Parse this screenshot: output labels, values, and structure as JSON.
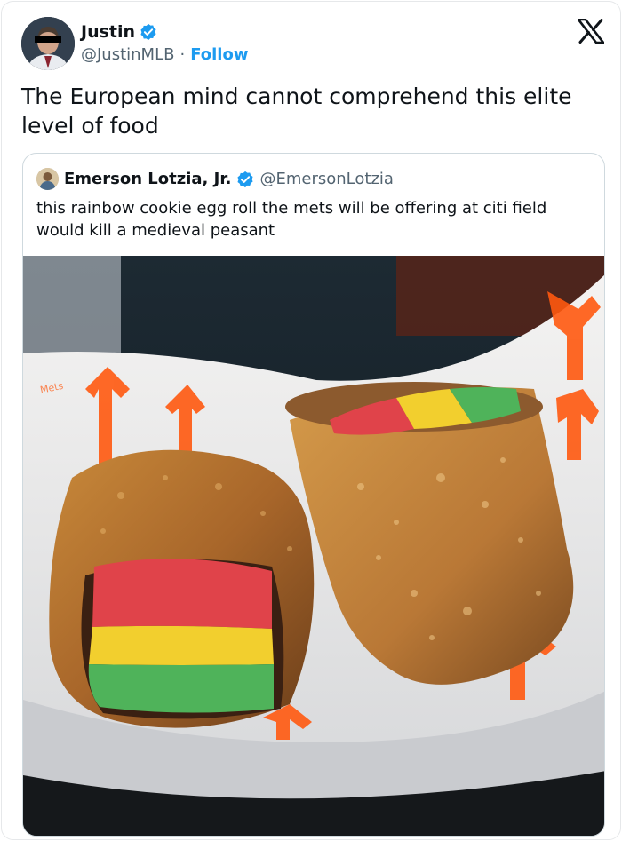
{
  "tweet": {
    "author_name": "Justin",
    "author_handle": "@JustinMLB",
    "separator": "·",
    "follow_label": "Follow",
    "text": "The European mind cannot comprehend this elite level of food"
  },
  "quoted_tweet": {
    "author_name": "Emerson Lotzia, Jr.",
    "author_handle": "@EmersonLotzia",
    "text": "this rainbow cookie egg roll the mets will be offering at citi field would kill a medieval peasant"
  },
  "colors": {
    "verified_badge": "#1d9bf0",
    "follow_link": "#1d9bf0",
    "mets_orange": "#ff5910",
    "cookie_red": "#e0434a",
    "cookie_yellow": "#f2cf2e",
    "cookie_green": "#4fb35a"
  },
  "icons": {
    "verified": "verified-badge-icon",
    "platform_logo": "x-logo-icon"
  }
}
